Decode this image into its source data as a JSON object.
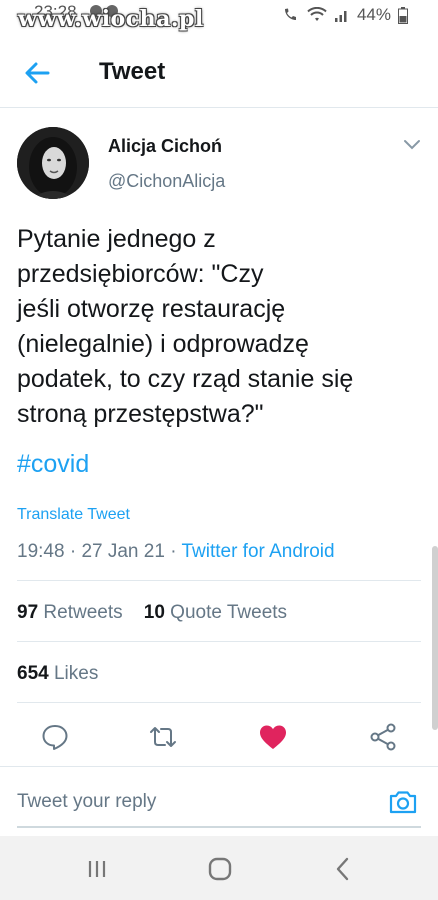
{
  "status_bar": {
    "time": "23:28",
    "watermark": "www.wiocha.pl",
    "battery": "44%"
  },
  "app_bar": {
    "title": "Tweet"
  },
  "tweet": {
    "author_name": "Alicja Cichoń",
    "author_handle": "@CichonAlicja",
    "text_lines": [
      "Pytanie jednego z",
      "przedsiębiorców: \"Czy",
      "jeśli otworzę restaurację",
      "(nielegalnie) i odprowadzę",
      "podatek, to czy rząd stanie się",
      "stroną przestępstwa?\""
    ],
    "hashtag": "#covid",
    "translate_label": "Translate Tweet",
    "time": "19:48",
    "separator": "·",
    "date": "27 Jan 21",
    "via": "Twitter for Android",
    "retweets_count": "97",
    "retweets_label": "Retweets",
    "quote_count": "10",
    "quote_label": "Quote Tweets",
    "likes_count": "654",
    "likes_label": "Likes"
  },
  "reply": {
    "placeholder": "Tweet your reply"
  },
  "colors": {
    "accent": "#1da1f2",
    "like": "#e0245e",
    "secondary_text": "#657786",
    "icon_gray": "#657786"
  },
  "icons": {
    "back": "arrow-left-icon",
    "more": "chevron-down-icon",
    "reply": "reply-icon",
    "retweet": "retweet-icon",
    "like": "heart-icon",
    "share": "share-icon",
    "camera": "camera-icon"
  }
}
